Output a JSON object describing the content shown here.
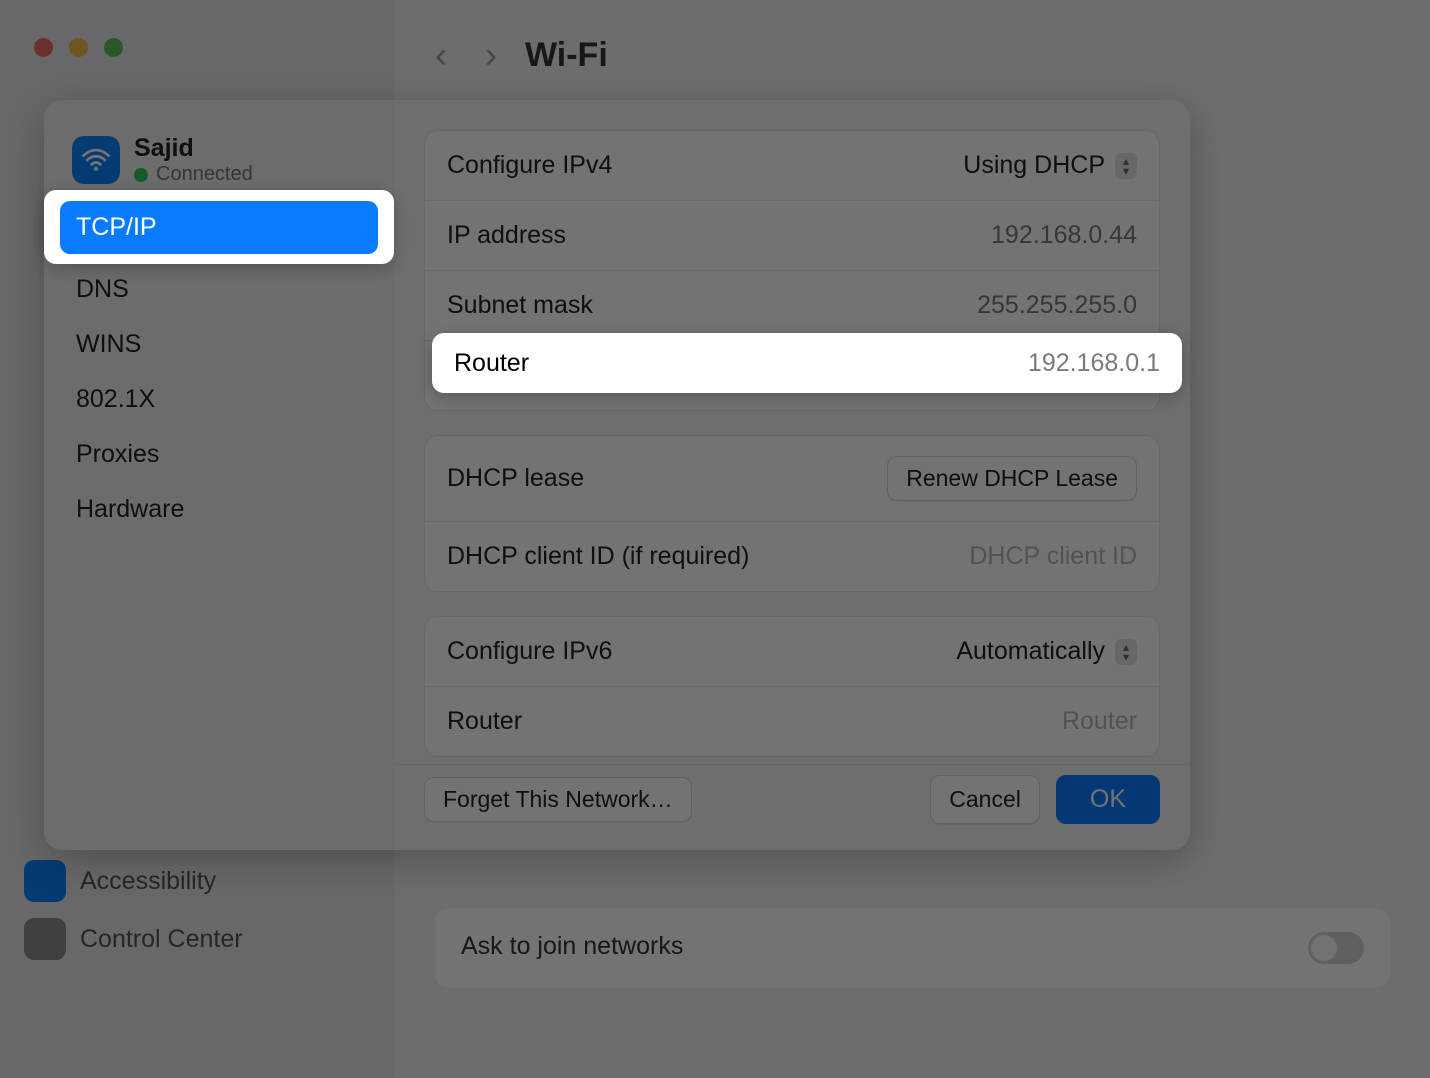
{
  "header": {
    "title": "Wi-Fi"
  },
  "network": {
    "name": "Sajid",
    "status": "Connected"
  },
  "tabs": [
    "TCP/IP",
    "DNS",
    "WINS",
    "802.1X",
    "Proxies",
    "Hardware"
  ],
  "selectedTab": "TCP/IP",
  "ipv4": {
    "configure_label": "Configure IPv4",
    "configure_value": "Using DHCP",
    "ip_label": "IP address",
    "ip_value": "192.168.0.44",
    "mask_label": "Subnet mask",
    "mask_value": "255.255.255.0",
    "router_label": "Router",
    "router_value": "192.168.0.1"
  },
  "dhcp": {
    "lease_label": "DHCP lease",
    "renew_btn": "Renew DHCP Lease",
    "client_label": "DHCP client ID (if required)",
    "client_placeholder": "DHCP client ID",
    "client_value": ""
  },
  "ipv6": {
    "configure_label": "Configure IPv6",
    "configure_value": "Automatically",
    "router_label": "Router",
    "router_placeholder": "Router"
  },
  "footer": {
    "forget": "Forget This Network…",
    "cancel": "Cancel",
    "ok": "OK"
  },
  "background": {
    "accessibility": "Accessibility",
    "control_center": "Control Center",
    "ask_row": "Ask to join networks"
  }
}
